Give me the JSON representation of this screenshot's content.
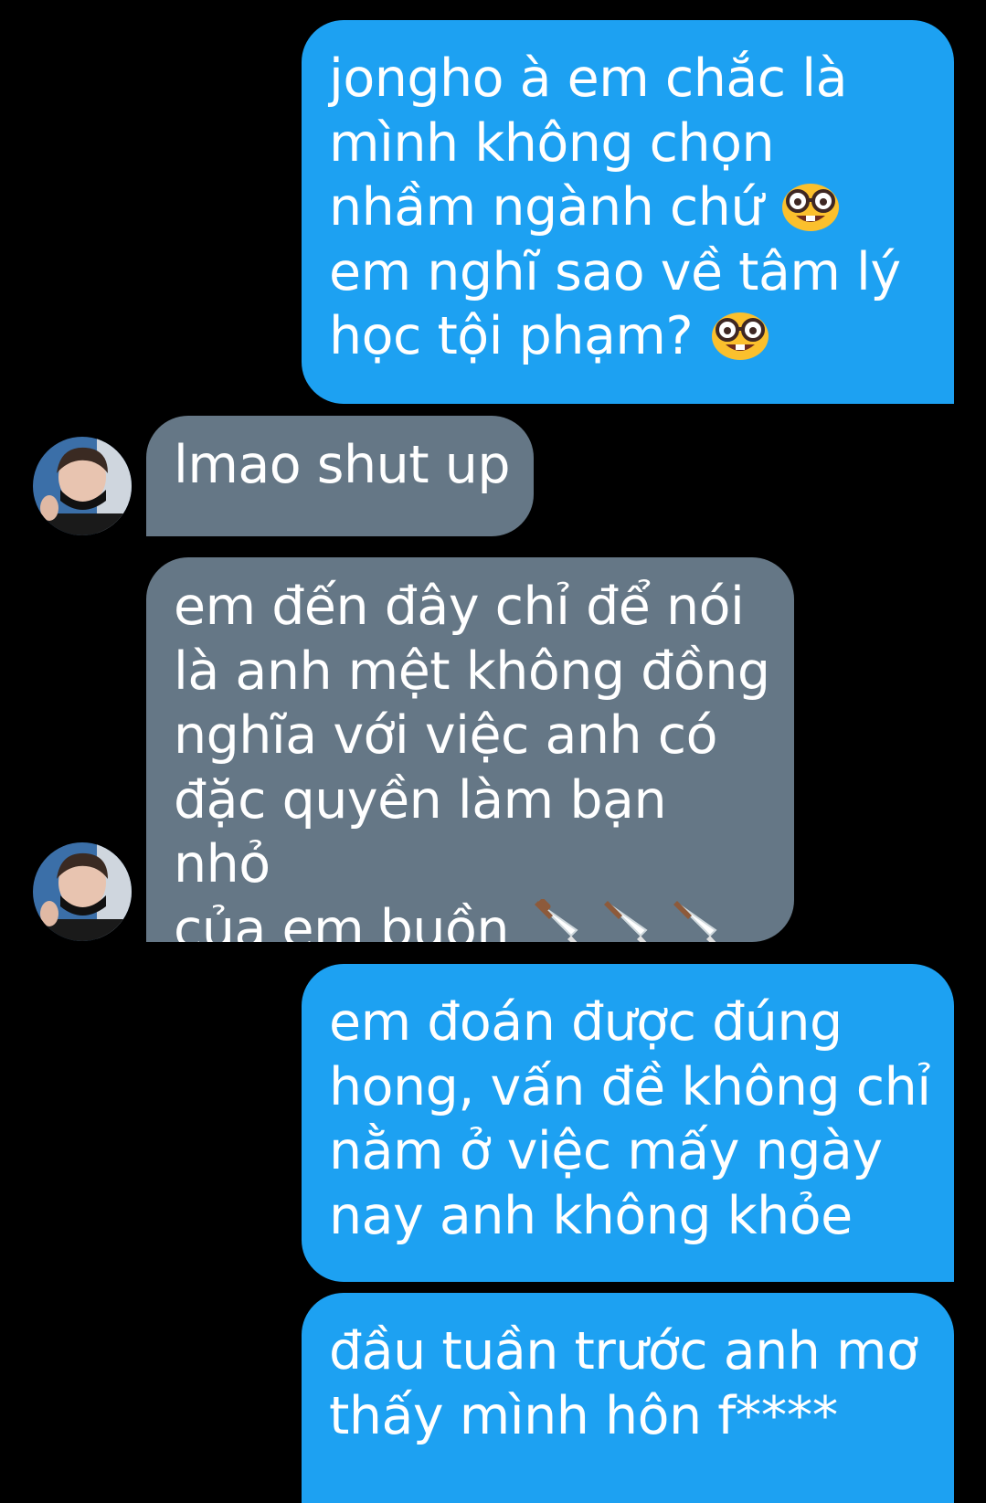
{
  "conversation": {
    "messages": [
      {
        "sender": "me",
        "text": "jongho à em chắc là\nmình không chọn\nnhầm ngành chứ ",
        "text_2": "\nem nghĩ sao về tâm lý\nhọc tội phạm? ",
        "emoji": "nerd-face"
      },
      {
        "sender": "other",
        "text": "lmao shut up"
      },
      {
        "sender": "other",
        "text": "em đến đây chỉ để nói\nlà anh mệt không đồng\nnghĩa với việc anh có\nđặc quyền làm bạn nhỏ\ncủa em buồn ",
        "emoji": "kitchen-knife",
        "emoji_count": 3
      },
      {
        "sender": "me",
        "text": "em đoán được đúng\nhong, vấn đề không chỉ\nnằm ở việc mấy ngày\nnay anh không khỏe"
      },
      {
        "sender": "me",
        "text": "đầu tuần trước anh mơ\nthấy mình hôn f****"
      }
    ]
  },
  "colors": {
    "background": "#000000",
    "sent_bubble": "#1da1f2",
    "received_bubble": "#657786",
    "text": "#ffffff"
  }
}
